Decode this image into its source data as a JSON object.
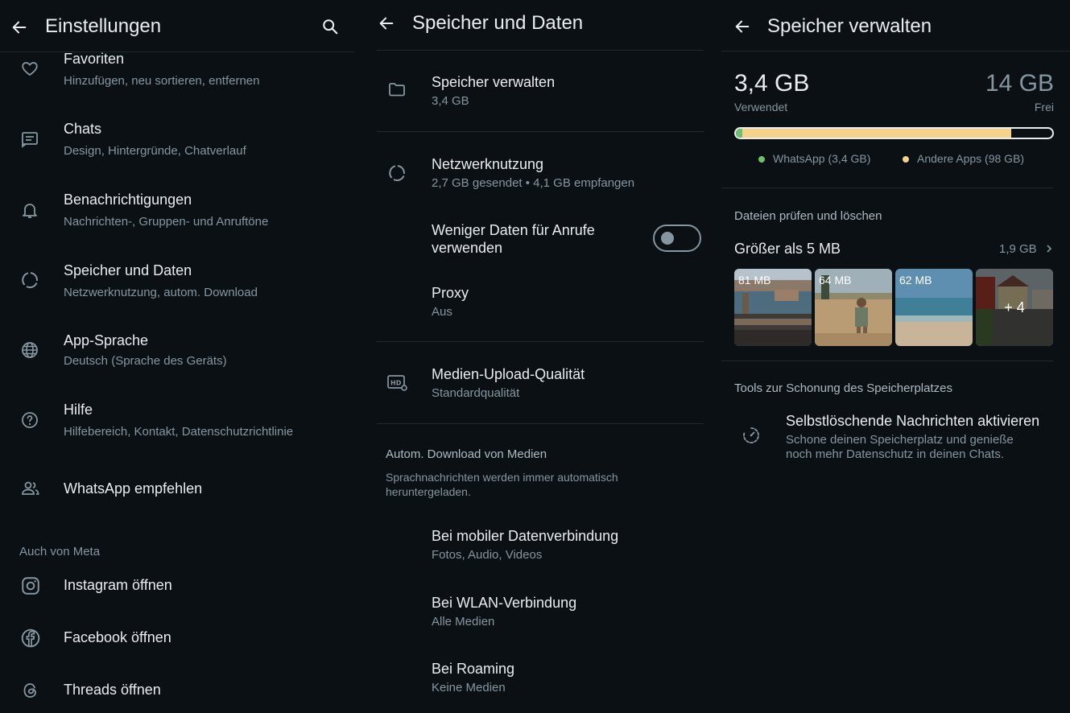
{
  "settings": {
    "title": "Einstellungen",
    "items": [
      {
        "title": "Favoriten",
        "subtitle": "Hinzufügen, neu sortieren, entfernen",
        "icon": "heart-icon"
      },
      {
        "title": "Chats",
        "subtitle": "Design, Hintergründe, Chatverlauf",
        "icon": "chat-icon"
      },
      {
        "title": "Benachrichtigungen",
        "subtitle": "Nachrichten-, Gruppen- und Anruftöne",
        "icon": "bell-icon"
      },
      {
        "title": "Speicher und Daten",
        "subtitle": "Netzwerknutzung, autom. Download",
        "icon": "data-usage-icon"
      },
      {
        "title": "App-Sprache",
        "subtitle": "Deutsch (Sprache des Geräts)",
        "icon": "globe-icon"
      },
      {
        "title": "Hilfe",
        "subtitle": "Hilfebereich, Kontakt, Datenschutzrichtlinie",
        "icon": "help-icon"
      },
      {
        "title": "WhatsApp empfehlen",
        "icon": "people-icon"
      }
    ],
    "meta_section": "Auch von Meta",
    "meta_items": [
      {
        "title": "Instagram öffnen",
        "icon": "instagram-icon"
      },
      {
        "title": "Facebook öffnen",
        "icon": "facebook-icon"
      },
      {
        "title": "Threads öffnen",
        "icon": "threads-icon"
      }
    ]
  },
  "storage_data": {
    "title": "Speicher und Daten",
    "manage": {
      "title": "Speicher verwalten",
      "subtitle": "3,4 GB"
    },
    "network": {
      "title": "Netzwerknutzung",
      "subtitle": "2,7 GB gesendet • 4,1 GB empfangen"
    },
    "less_data": {
      "title_line1": "Weniger Daten für Anrufe",
      "title_line2": "verwenden",
      "enabled": false
    },
    "proxy": {
      "title": "Proxy",
      "subtitle": "Aus"
    },
    "media_quality": {
      "title": "Medien-Upload-Qualität",
      "subtitle": "Standardqualität"
    },
    "auto_download": {
      "section": "Autom. Download von Medien",
      "note_line1": "Sprachnachrichten werden immer automatisch",
      "note_line2": "heruntergeladen.",
      "items": [
        {
          "title": "Bei mobiler Datenverbindung",
          "subtitle": "Fotos, Audio, Videos"
        },
        {
          "title": "Bei WLAN-Verbindung",
          "subtitle": "Alle Medien"
        },
        {
          "title": "Bei Roaming",
          "subtitle": "Keine Medien"
        }
      ]
    }
  },
  "manage_storage": {
    "title": "Speicher verwalten",
    "used_value": "3,4 GB",
    "used_label": "Verwendet",
    "free_value": "14 GB",
    "free_label": "Frei",
    "usage_bar": {
      "whatsapp_fraction": 0.02,
      "other_fraction": 0.85,
      "whatsapp_color": "#6fbf6e",
      "other_color": "#f5d38a"
    },
    "legend": {
      "whatsapp": "WhatsApp (3,4 GB)",
      "other": "Andere Apps (98 GB)"
    },
    "review_section": "Dateien prüfen und löschen",
    "larger_than": {
      "title": "Größer als 5 MB",
      "value": "1,9 GB"
    },
    "thumbnails": [
      {
        "label": "81 MB"
      },
      {
        "label": "64 MB"
      },
      {
        "label": "62 MB"
      },
      {
        "label": "+ 4"
      }
    ],
    "tools_section": "Tools zur Schonung des Speicherplatzes",
    "disappearing": {
      "title": "Selbstlöschende Nachrichten aktivieren",
      "subtitle_line1": "Schone deinen Speicherplatz und genieße",
      "subtitle_line2": "noch mehr Datenschutz in deinen Chats."
    }
  }
}
